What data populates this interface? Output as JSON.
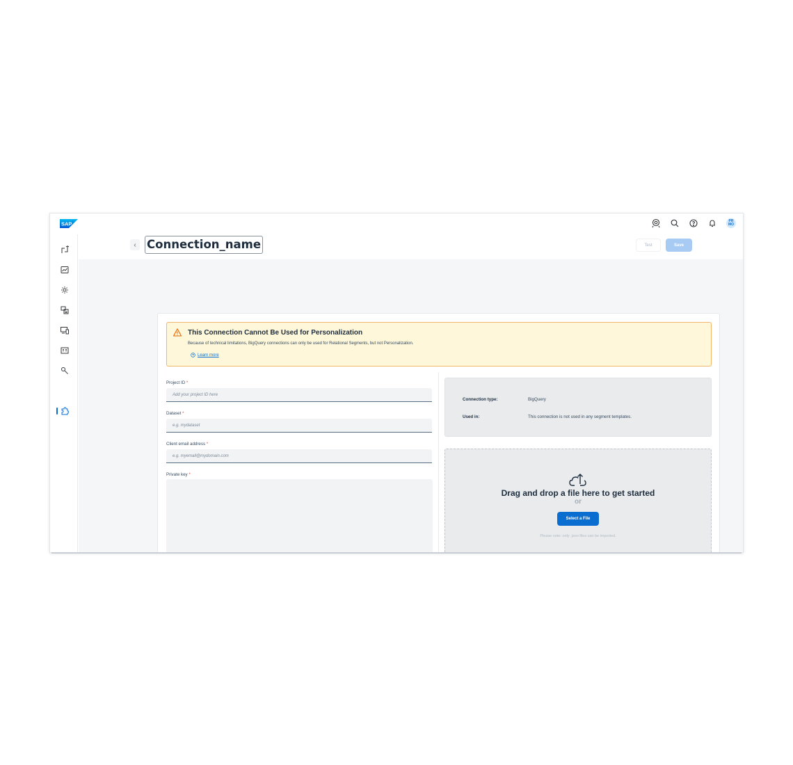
{
  "shell": {
    "logo_text": "SAP",
    "avatar_initials": "PR MO",
    "actions": [
      "assistant-icon",
      "search-icon",
      "help-icon",
      "notification-icon"
    ]
  },
  "sidebar": {
    "items": [
      {
        "icon": "pipeline-icon"
      },
      {
        "icon": "analytics-chart-icon"
      },
      {
        "icon": "settings-gear-icon"
      },
      {
        "icon": "segments-icon"
      },
      {
        "icon": "devices-icon"
      },
      {
        "icon": "catalog-icon"
      },
      {
        "icon": "tools-wrench-icon"
      },
      {
        "icon": "integrations-puzzle-icon",
        "active": true
      }
    ]
  },
  "header": {
    "title": "Connection_name",
    "test_label": "Test",
    "save_label": "Save"
  },
  "warning": {
    "title": "This Connection Cannot Be Used for Personalization",
    "text": "Because of technical limitations, BigQuery connections can only be used for Relational Segments, but not Personalization.",
    "link_label": "Learn more"
  },
  "form": {
    "project_id": {
      "label": "Project ID",
      "required_mark": "*",
      "placeholder": "Add your project ID here"
    },
    "dataset": {
      "label": "Dataset",
      "required_mark": "*",
      "placeholder": "e.g. mydataset"
    },
    "client_email": {
      "label": "Client email address",
      "required_mark": "*",
      "placeholder": "e.g. myemail@mydomain.com"
    },
    "private_key": {
      "label": "Private key",
      "required_mark": "*"
    }
  },
  "info": {
    "type_label": "Connection type:",
    "type_value": "BigQuery",
    "used_label": "Used in:",
    "used_value": "This connection is not used in any segment templates."
  },
  "dropzone": {
    "title": "Drag and drop a file here to get started",
    "or_text": "or",
    "button_label": "Select a File",
    "note": "Please note: only .json files can be imported."
  },
  "colors": {
    "accent": "#0a6ed1",
    "warning_bg": "#fef7d9",
    "warning_border": "#f1b56b",
    "required": "#e24c4c"
  }
}
